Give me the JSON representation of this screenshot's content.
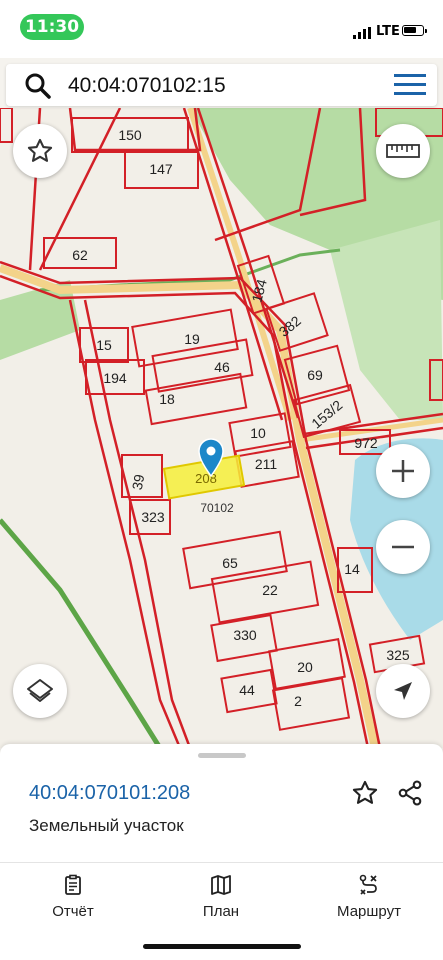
{
  "status_bar": {
    "time": "11:30",
    "network": "LTE"
  },
  "search": {
    "query": "40:04:070102:15"
  },
  "map": {
    "quarter_label": "70102",
    "selected_parcel": "208",
    "parcels": [
      "150",
      "147",
      "62",
      "184",
      "382",
      "15",
      "19",
      "194",
      "46",
      "69",
      "18",
      "153/2",
      "10",
      "972",
      "39",
      "211",
      "323",
      "65",
      "14",
      "22",
      "330",
      "20",
      "325",
      "44",
      "2"
    ]
  },
  "sheet": {
    "cadastral_number": "40:04:070101:208",
    "object_type": "Земельный участок"
  },
  "tabs": {
    "report": "Отчёт",
    "plan": "План",
    "route": "Маршрут"
  },
  "colors": {
    "accent": "#1b63a8",
    "parcel_border": "#d32027",
    "selected_fill": "#f6ef3a",
    "water": "#a9dbe8",
    "green": "#a7d390"
  }
}
